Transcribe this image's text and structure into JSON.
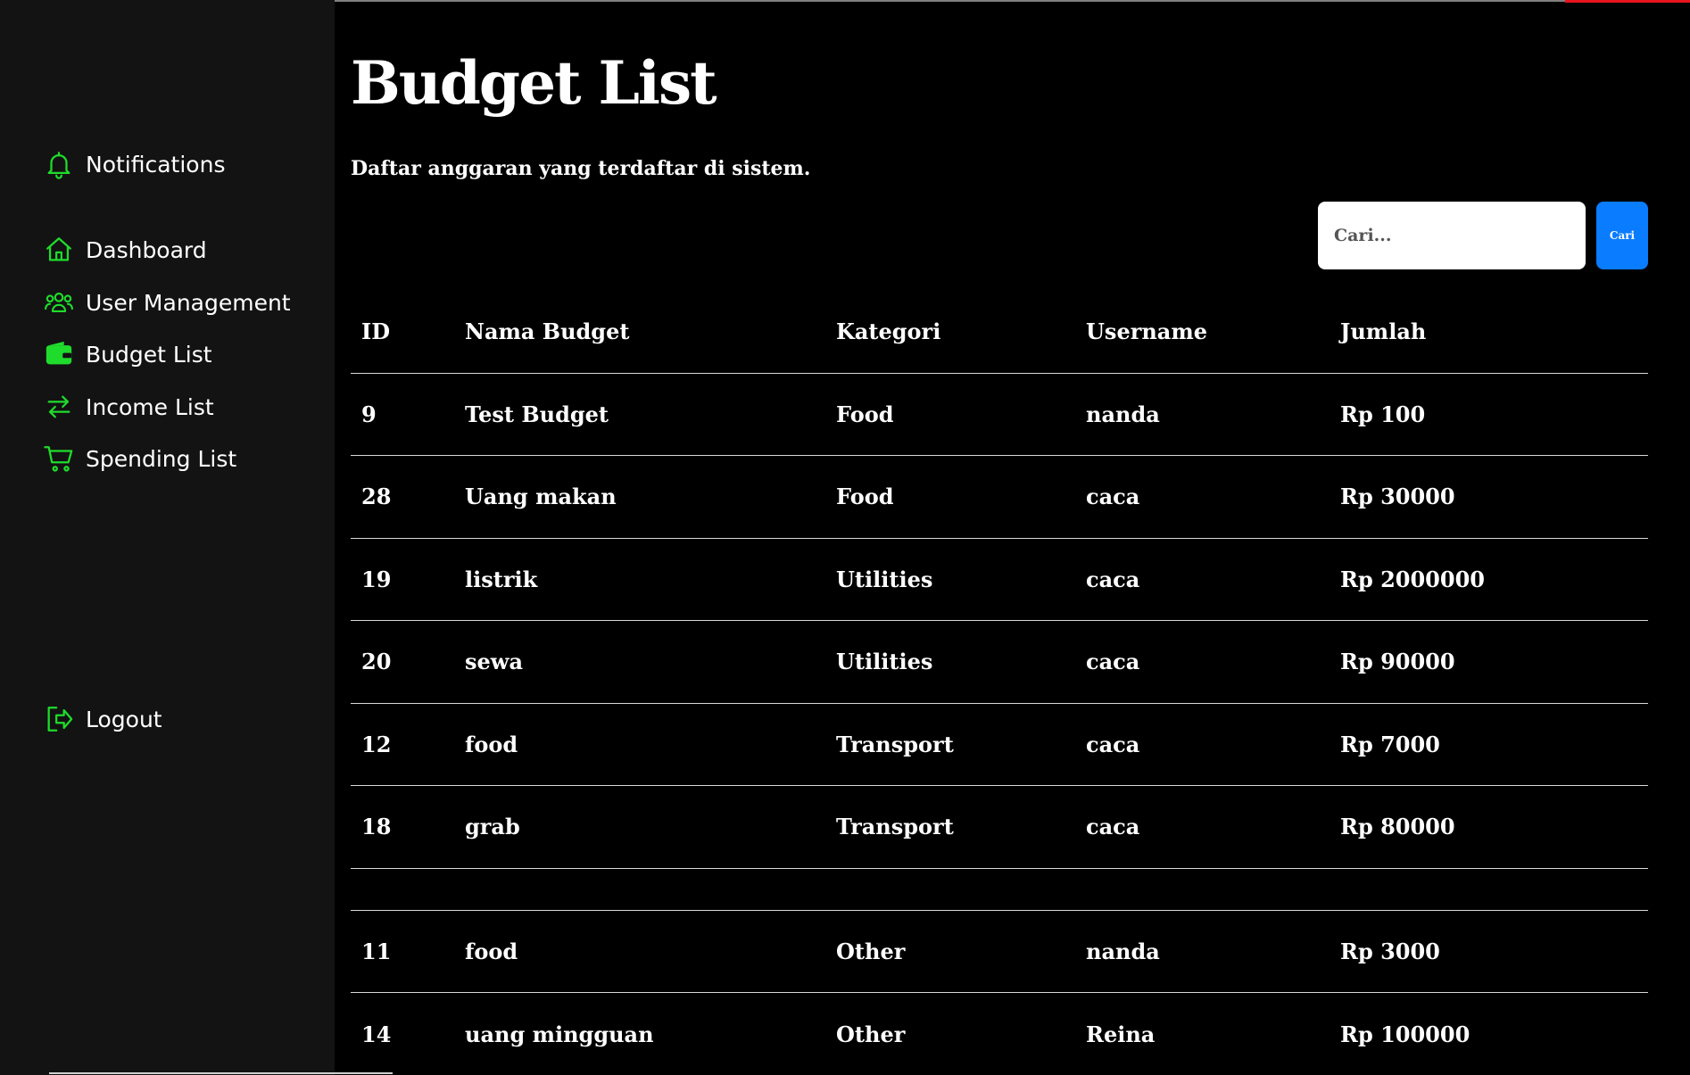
{
  "accent_color": "#1fdc2c",
  "sidebar": {
    "notifications": {
      "label": "Notifications",
      "icon": "bell-icon"
    },
    "items": [
      {
        "label": "Dashboard",
        "icon": "home-icon"
      },
      {
        "label": "User Management",
        "icon": "users-icon"
      },
      {
        "label": "Budget List",
        "icon": "wallet-icon"
      },
      {
        "label": "Income List",
        "icon": "transfer-icon"
      },
      {
        "label": "Spending List",
        "icon": "cart-icon"
      }
    ],
    "logout": {
      "label": "Logout",
      "icon": "logout-icon"
    }
  },
  "main": {
    "title": "Budget List",
    "subtitle": "Daftar anggaran yang terdaftar di sistem.",
    "search": {
      "placeholder": "Cari...",
      "value": "",
      "button_label": "Cari"
    }
  },
  "table": {
    "headers": [
      "ID",
      "Nama Budget",
      "Kategori",
      "Username",
      "Jumlah"
    ],
    "rows": [
      [
        "9",
        "Test Budget",
        "Food",
        "nanda",
        "Rp 100"
      ],
      [
        "28",
        "Uang makan",
        "Food",
        "caca",
        "Rp 30000"
      ],
      [
        "19",
        "listrik",
        "Utilities",
        "caca",
        "Rp 2000000"
      ],
      [
        "20",
        "sewa",
        "Utilities",
        "caca",
        "Rp 90000"
      ],
      [
        "12",
        "food",
        "Transport",
        "caca",
        "Rp 7000"
      ],
      [
        "18",
        "grab",
        "Transport",
        "caca",
        "Rp 80000"
      ],
      [
        "",
        "",
        "",
        "",
        ""
      ],
      [
        "11",
        "food",
        "Other",
        "nanda",
        "Rp 3000"
      ],
      [
        "14",
        "uang mingguan",
        "Other",
        "Reina",
        "Rp 100000"
      ]
    ]
  }
}
